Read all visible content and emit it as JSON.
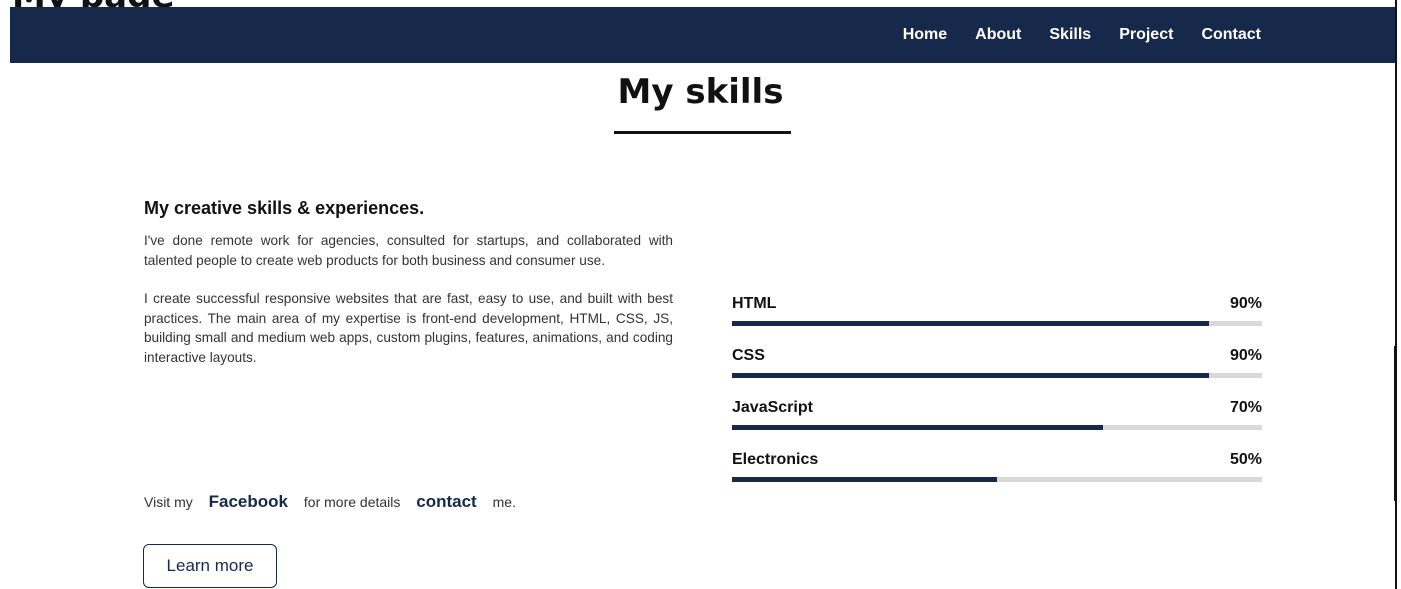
{
  "cropped_heading": "My page",
  "nav": {
    "items": [
      "Home",
      "About",
      "Skills",
      "Project",
      "Contact"
    ]
  },
  "section": {
    "title": "My skills"
  },
  "intro": {
    "heading": "My creative skills & experiences.",
    "paragraph1": "I've done remote work for agencies, consulted for startups, and collaborated with talented people to create web products for both business and consumer use.",
    "paragraph2": "I create successful responsive websites that are fast, easy to use, and built with best practices. The main area of my expertise is front-end development, HTML, CSS, JS, building small and medium web apps, custom plugins, features, animations, and coding interactive layouts."
  },
  "visit": {
    "prefix": "Visit my",
    "facebook_label": "Facebook",
    "middle": "for more details",
    "contact_label": "contact",
    "suffix": "me."
  },
  "learn_more_label": "Learn more",
  "skills": [
    {
      "name": "HTML",
      "percent_label": "90%",
      "level": 0.9
    },
    {
      "name": "CSS",
      "percent_label": "90%",
      "level": 0.9
    },
    {
      "name": "JavaScript",
      "percent_label": "70%",
      "level": 0.7
    },
    {
      "name": "Electronics",
      "percent_label": "50%",
      "level": 0.5
    }
  ],
  "colors": {
    "navy": "#17294a",
    "track": "#d9d9d9"
  }
}
